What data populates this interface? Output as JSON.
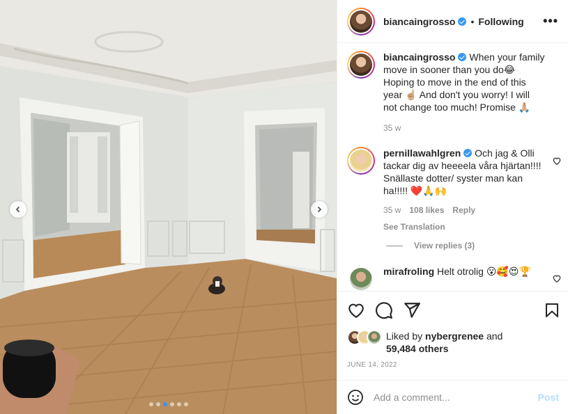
{
  "post": {
    "photo": {
      "carousel_dots": 6,
      "active_dot": 3
    },
    "author": {
      "username": "biancaingrosso",
      "verified": true
    },
    "header": {
      "separator": "•",
      "follow_status": "Following",
      "more_label": "•••"
    },
    "caption": {
      "username": "biancaingrosso",
      "text": "When your family move in sooner than you do😂 Hoping to move in the end of this year ☝🏼 And don't you worry! I will not change too much! Promise 🙏🏼",
      "time": "35 w"
    },
    "comments": [
      {
        "username": "pernillawahlgren",
        "verified": true,
        "text": "Och jag & Olli tackar dig av heeeela våra hjärtan!!!! Snällaste dotter/ syster man kan ha!!!!! ❤️🙏🙌",
        "time": "35 w",
        "likes": "108 likes",
        "reply_label": "Reply",
        "see_translation": "See Translation",
        "view_replies": "View replies (3)"
      },
      {
        "username": "mirafroling",
        "verified": false,
        "text": "Helt otrolig 😮🥰😍🏆"
      }
    ],
    "liked_by": {
      "prefix": "Liked by",
      "user": "nybergrenee",
      "and": "and",
      "others": "59,484 others"
    },
    "date": "JUNE 14, 2022",
    "add_comment": {
      "placeholder": "Add a comment...",
      "post_label": "Post"
    },
    "icons": [
      "chevron-left-icon",
      "chevron-right-icon",
      "heart-icon",
      "comment-icon",
      "share-icon",
      "bookmark-icon",
      "emoji-icon",
      "verified-icon"
    ],
    "colors": {
      "accent": "#3897f0",
      "text": "#262626",
      "muted": "#8e8e8e",
      "post_disabled": "#b2dffc"
    }
  }
}
